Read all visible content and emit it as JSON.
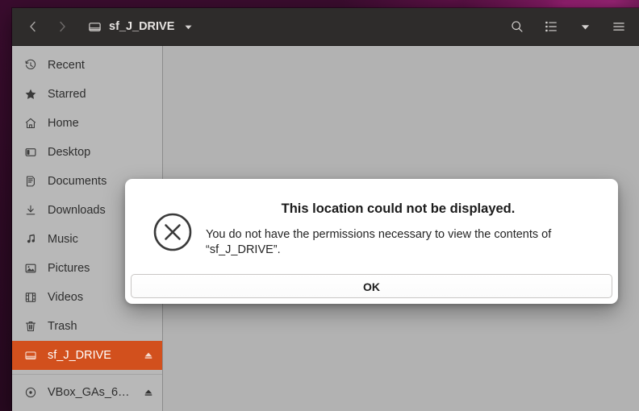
{
  "window": {
    "header": {
      "title": "sf_J_DRIVE",
      "drive_icon": "drive-harddisk-icon",
      "dropdown_icon": "chevron-down-icon",
      "back_icon": "chevron-left-icon",
      "forward_icon": "chevron-right-icon",
      "actions": [
        {
          "name": "search-icon",
          "label": "Search"
        },
        {
          "name": "list-view-icon",
          "label": "List view"
        },
        {
          "name": "view-options-chevron-down-icon",
          "label": "View options"
        },
        {
          "name": "hamburger-menu-icon",
          "label": "Main menu"
        }
      ]
    },
    "sidebar": {
      "items": [
        {
          "label": "Recent",
          "icon": "clock-icon",
          "selected": false,
          "eject": false
        },
        {
          "label": "Starred",
          "icon": "star-icon",
          "selected": false,
          "eject": false
        },
        {
          "label": "Home",
          "icon": "home-icon",
          "selected": false,
          "eject": false
        },
        {
          "label": "Desktop",
          "icon": "desktop-icon",
          "selected": false,
          "eject": false
        },
        {
          "label": "Documents",
          "icon": "document-icon",
          "selected": false,
          "eject": false
        },
        {
          "label": "Downloads",
          "icon": "download-icon",
          "selected": false,
          "eject": false
        },
        {
          "label": "Music",
          "icon": "music-note-icon",
          "selected": false,
          "eject": false
        },
        {
          "label": "Pictures",
          "icon": "picture-icon",
          "selected": false,
          "eject": false
        },
        {
          "label": "Videos",
          "icon": "film-icon",
          "selected": false,
          "eject": false
        },
        {
          "label": "Trash",
          "icon": "trash-icon",
          "selected": false,
          "eject": false
        },
        {
          "label": "sf_J_DRIVE",
          "icon": "drive-harddisk-icon",
          "selected": true,
          "eject": true
        },
        {
          "label": "VBox_GAs_6…",
          "icon": "optical-disc-icon",
          "selected": false,
          "eject": true
        }
      ]
    },
    "dialog": {
      "icon": "error-circle-x-icon",
      "title": "This location could not be displayed.",
      "message": "You do not have the permissions necessary to view the contents of “sf_J_DRIVE”.",
      "ok_label": "OK"
    }
  },
  "colors": {
    "header_bg": "#2e2c2b",
    "sidebar_bg": "#b8b8b8",
    "main_bg": "#b2b2b2",
    "selection_orange": "#d2501d",
    "dialog_bg": "#ffffff",
    "wallpaper_purple": "#2d0a24"
  }
}
